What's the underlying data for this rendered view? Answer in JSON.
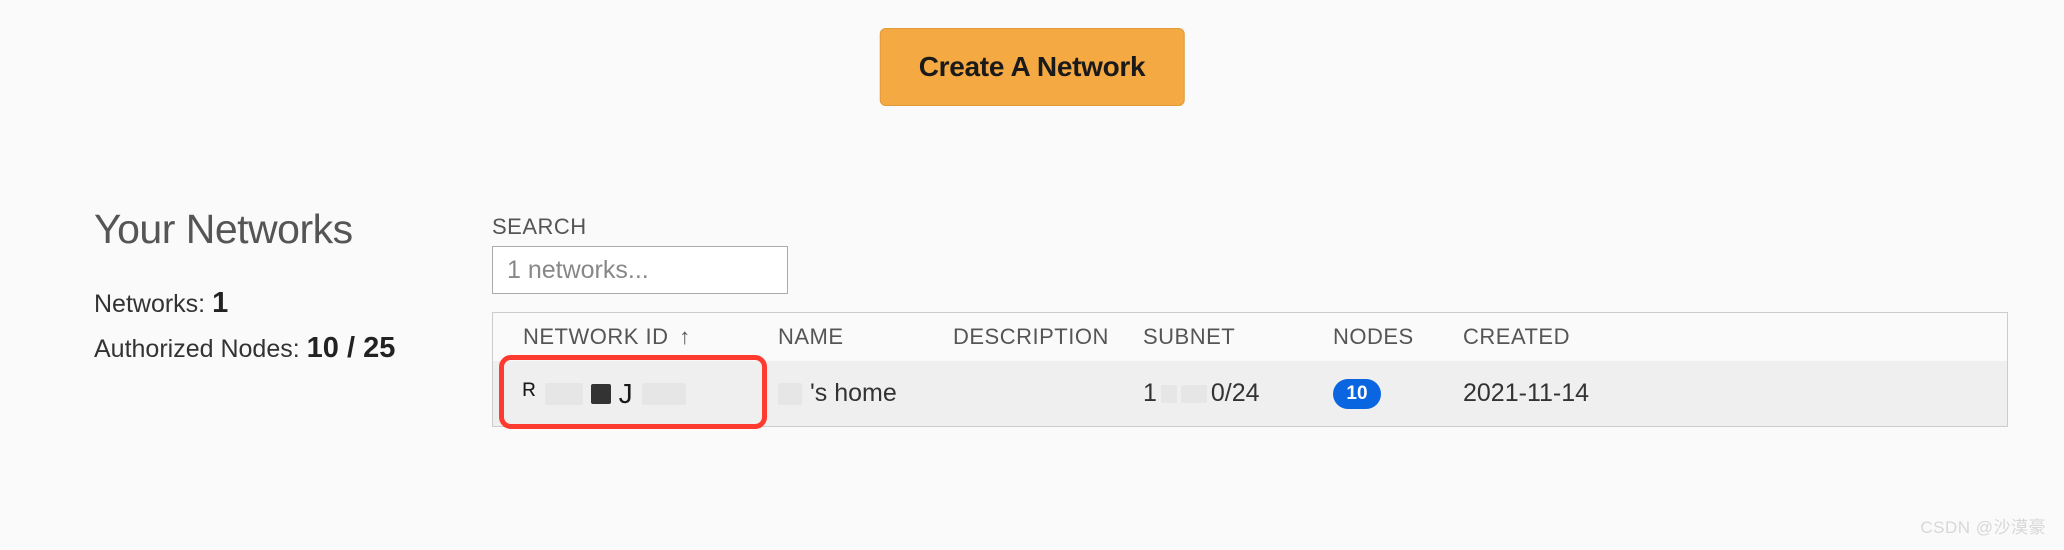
{
  "createButton": {
    "label": "Create A Network"
  },
  "heading": "Your Networks",
  "stats": {
    "networksLabel": "Networks:",
    "networksCount": "1",
    "nodesLabel": "Authorized Nodes:",
    "nodesCount": "10 / 25"
  },
  "search": {
    "label": "SEARCH",
    "placeholder": "1 networks..."
  },
  "table": {
    "headers": {
      "id": "NETWORK ID",
      "sortArrow": "↑",
      "name": "NAME",
      "description": "DESCRIPTION",
      "subnet": "SUBNET",
      "nodes": "NODES",
      "created": "CREATED"
    },
    "rows": [
      {
        "idFragments": {
          "a": "ᴿ",
          "b": "J"
        },
        "nameSuffix": "'s home",
        "description": "",
        "subnetPrefix": "1",
        "subnetSuffix": "0/24",
        "nodes": "10",
        "created": "2021-11-14"
      }
    ]
  },
  "watermark": "CSDN @沙漠豪"
}
